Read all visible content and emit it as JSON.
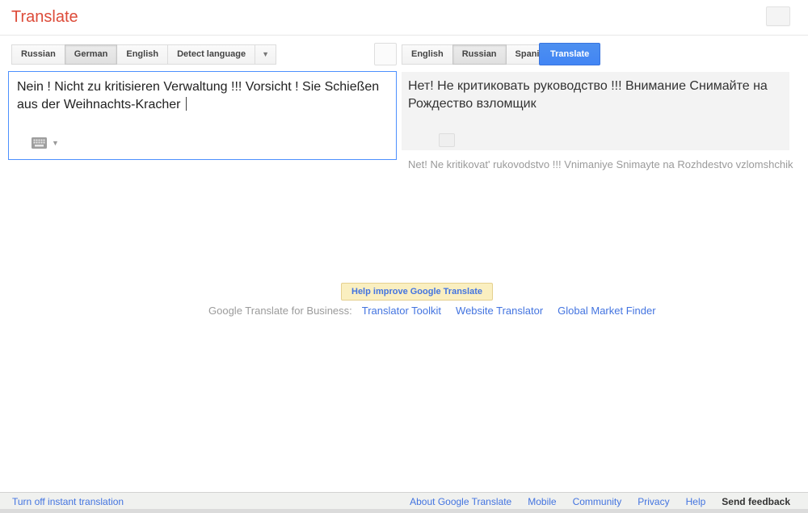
{
  "header": {
    "title": "Translate"
  },
  "icons": {
    "dropdown_arrow": "▼",
    "keyboard_arrow": "▼"
  },
  "source": {
    "tabs": [
      {
        "label": "Russian",
        "selected": false
      },
      {
        "label": "German",
        "selected": true
      },
      {
        "label": "English",
        "selected": false
      },
      {
        "label": "Detect language",
        "selected": false
      }
    ],
    "text": "Nein ! Nicht zu kritisieren Verwaltung !!! Vorsicht ! Sie Schießen aus der Weihnachts-Kracher "
  },
  "target": {
    "tabs": [
      {
        "label": "English",
        "selected": false
      },
      {
        "label": "Russian",
        "selected": true
      },
      {
        "label": "Spanish",
        "selected": false
      }
    ],
    "translate_button": "Translate",
    "text": "Нет! Не критиковать руководство !!! Внимание Снимайте на Рождество взломщик",
    "transliteration": "Net! Ne kritikovat' rukovodstvo !!! Vnimaniye Snimayte na Rozhdestvo vzlomshchik"
  },
  "promo": {
    "help_button": "Help improve Google Translate",
    "business_label": "Google Translate for Business:",
    "links": [
      "Translator Toolkit",
      "Website Translator",
      "Global Market Finder"
    ]
  },
  "footer": {
    "left_link": "Turn off instant translation",
    "links": [
      "About Google Translate",
      "Mobile",
      "Community",
      "Privacy",
      "Help"
    ],
    "feedback": "Send feedback"
  },
  "colors": {
    "title_red": "#dd4b39",
    "link_blue": "#4374e0",
    "translate_button_blue": "#4285f4",
    "focus_border_blue": "#4d90fe",
    "panel_gray": "#f3f3f3",
    "promo_yellow": "#faefc0"
  }
}
